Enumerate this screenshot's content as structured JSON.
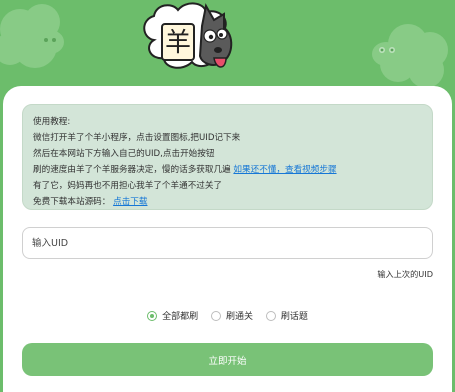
{
  "mascot": {
    "character": "羊"
  },
  "tutorial": {
    "title": "使用教程:",
    "line1": "微信打开羊了个羊小程序，点击设置图标,把UID记下来",
    "line2": "然后在本网站下方输入自己的UID,点击开始按钮",
    "line3_text": "刷的速度由羊了个羊服务器决定，慢的话多获取几遍",
    "line3_link": "如果还不懂，查看视频步骤",
    "line4": "有了它，妈妈再也不用担心我羊了个羊通不过关了",
    "line5_text": "免费下载本站源码：",
    "line5_link": "点击下载"
  },
  "uid_input": {
    "placeholder": "输入UID",
    "value": ""
  },
  "last_uid_label": "输入上次的UID",
  "modes": [
    {
      "label": "全部都刷",
      "checked": true
    },
    {
      "label": "刷通关",
      "checked": false
    },
    {
      "label": "刷话题",
      "checked": false
    }
  ],
  "start_button": "立即开始",
  "colors": {
    "background": "#6cbd6b",
    "button": "#79c277",
    "tutorial_bg": "#d3e5d8",
    "link": "#1677d6"
  }
}
